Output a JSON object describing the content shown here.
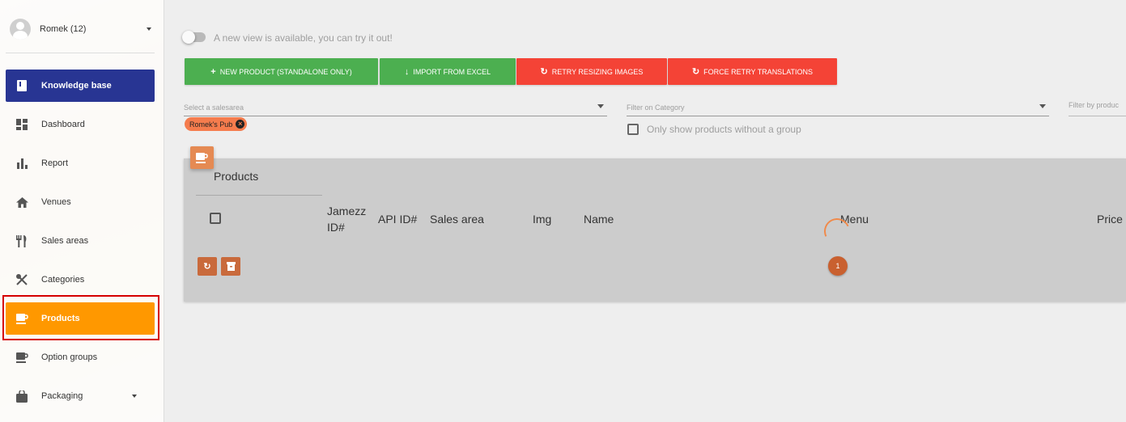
{
  "user": {
    "name": "Romek (12)"
  },
  "nav": {
    "knowledge_base": "Knowledge base",
    "items": [
      {
        "label": "Dashboard",
        "icon": "dashboard-icon"
      },
      {
        "label": "Report",
        "icon": "bar-chart-icon"
      },
      {
        "label": "Venues",
        "icon": "home-icon"
      },
      {
        "label": "Sales areas",
        "icon": "fork-knife-icon"
      },
      {
        "label": "Categories",
        "icon": "crossed-utensils-icon"
      },
      {
        "label": "Products",
        "icon": "cup-icon"
      },
      {
        "label": "Option groups",
        "icon": "cup-icon"
      },
      {
        "label": "Packaging",
        "icon": "bag-icon"
      }
    ]
  },
  "toggle": {
    "text": "A new view is available, you can try it out!"
  },
  "toolbar": {
    "new_product": "NEW PRODUCT (STANDALONE ONLY)",
    "import_excel": "IMPORT FROM EXCEL",
    "retry_resizing": "RETRY RESIZING IMAGES",
    "force_retry": "FORCE RETRY TRANSLATIONS"
  },
  "filters": {
    "salesarea_placeholder": "Select a salesarea",
    "salesarea_chip": "Romek's Pub",
    "category_placeholder": "Filter on Category",
    "only_without_group": "Only show products without a group",
    "filter_by_product": "Filter by produc"
  },
  "table": {
    "title": "Products",
    "columns": {
      "jamezz_id": "Jamezz ID#",
      "api_id": "API ID#",
      "sales_area": "Sales area",
      "img": "Img",
      "name": "Name",
      "menu": "Menu",
      "price": "Price"
    },
    "page": "1"
  },
  "colors": {
    "sidebar_kb": "#283593",
    "active_nav": "#ff9800",
    "green_button": "#4caf50",
    "red_button": "#f44336",
    "accent": "#e58a53"
  }
}
